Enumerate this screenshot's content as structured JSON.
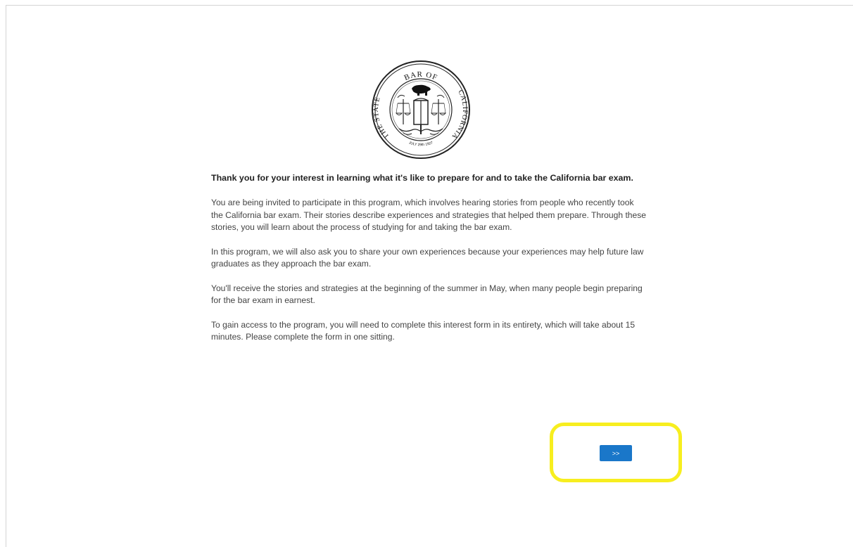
{
  "seal": {
    "text_top": "BAR OF",
    "text_left": "THE STATE",
    "text_right": "CALIFORNIA",
    "text_bottom": "JULY 29th 1927"
  },
  "intro": {
    "title": "Thank you for your interest in learning what it's like to prepare for and to take the California bar exam.",
    "paragraphs": [
      "You are being invited to participate in this program, which involves hearing stories from people who recently took the California bar exam. Their stories describe experiences and strategies that helped them prepare. Through these stories, you will learn about the process of studying for and taking the bar exam.",
      "In this program, we will also ask you to share your own experiences because your experiences may help future law graduates as they approach the bar exam.",
      "You'll receive the stories and strategies at the beginning of the summer in May, when many people begin preparing for the bar exam in earnest.",
      "To gain access to the program, you will need to complete this interest form in its entirety, which will take about 15 minutes. Please complete the form in one sitting."
    ]
  },
  "navigation": {
    "next_label": ">>"
  },
  "colors": {
    "button": "#1a77c9",
    "highlight": "#f7ee1f"
  }
}
